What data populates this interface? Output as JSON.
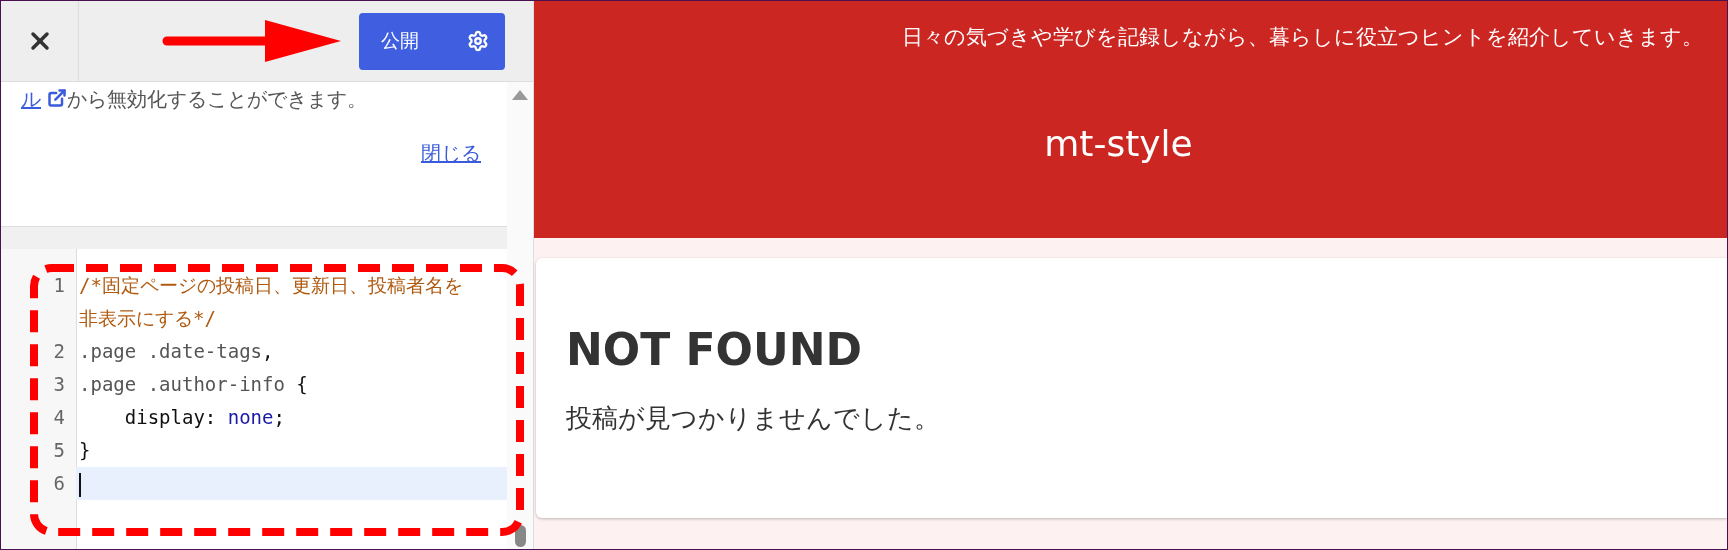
{
  "header": {
    "publish_button": "公開"
  },
  "notice": {
    "link": "ル",
    "text": "から無効化することができます。",
    "dismiss": "閉じる"
  },
  "editor": {
    "lines": [
      {
        "number": "1",
        "active": false,
        "tokens": [
          {
            "kind": "comment",
            "text": "/*固定ページの投稿日、更新日、投稿者名を非表示にする*/"
          }
        ]
      },
      {
        "number": "2",
        "active": false,
        "tokens": [
          {
            "kind": "selector",
            "text": ".page .date-tags"
          },
          {
            "kind": "punct",
            "text": ","
          }
        ]
      },
      {
        "number": "3",
        "active": false,
        "tokens": [
          {
            "kind": "selector",
            "text": ".page .author-info"
          },
          {
            "kind": "punct",
            "text": " {"
          }
        ]
      },
      {
        "number": "4",
        "active": false,
        "tokens": [
          {
            "kind": "property",
            "text": "    display"
          },
          {
            "kind": "punct",
            "text": ": "
          },
          {
            "kind": "value",
            "text": "none"
          },
          {
            "kind": "punct",
            "text": ";"
          }
        ]
      },
      {
        "number": "5",
        "active": false,
        "tokens": [
          {
            "kind": "punct",
            "text": "}"
          }
        ]
      },
      {
        "number": "6",
        "active": true
      }
    ]
  },
  "site": {
    "tagline": "日々の気づきや学びを記録しながら、暮らしに役立つヒントを紹介していきます。",
    "title": "mt-style"
  },
  "content": {
    "heading": "NOT FOUND",
    "message": "投稿が見つかりませんでした。"
  }
}
